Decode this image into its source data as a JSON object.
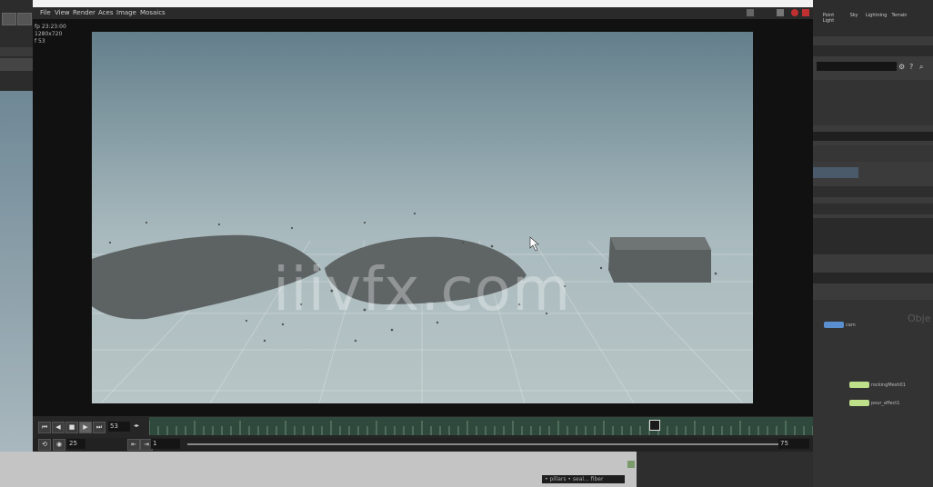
{
  "flipbook": {
    "menus": [
      "File",
      "View",
      "Render",
      "Aces",
      "Image",
      "Mosaics"
    ],
    "hud": [
      "fp 23:23:00",
      "1280x720",
      "f 53"
    ],
    "playbar": {
      "current_frame": "53",
      "fps": "25",
      "range_start": "1",
      "range_end": "75",
      "play_glyphs": [
        "⏮",
        "◀",
        "■",
        "▶",
        "⏭"
      ]
    }
  },
  "watermark": "iiivfx.com",
  "right": {
    "shelf_tools": [
      "Point Light",
      "Sky",
      "Lightning",
      "Terrain"
    ],
    "network_label": "Obje",
    "nodes": [
      "cam",
      "rockingMesh01",
      "pour_effect1"
    ]
  },
  "bottom": {
    "status": "• pillars • seal... fiber"
  },
  "colors": {
    "accent_node_blue": "#5a8fd0",
    "accent_node_green": "#bfe08a",
    "timeline_green": "#2f4a3c"
  }
}
